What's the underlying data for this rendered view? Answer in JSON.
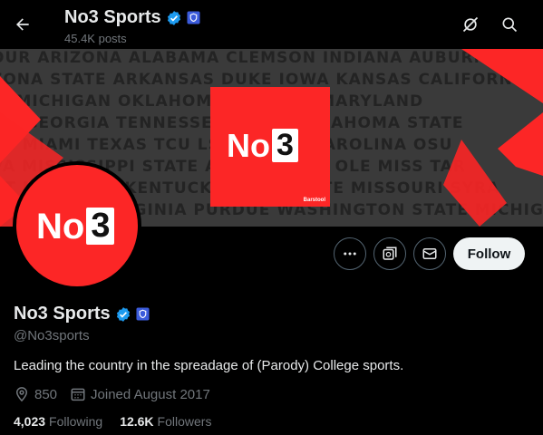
{
  "header": {
    "title": "No3 Sports",
    "posts": "45.4K posts"
  },
  "banner": {
    "logo_text": "No",
    "logo_digit": "3",
    "tag": "Barstool",
    "rows": [
      "OUR   ARIZONA   ALABAMA   CLEMSON   INDIANA   AUBURN",
      "ZONA STATE   ARKANSAS   DUKE   IOWA   KANSAS   CALIFORNIA",
      "IS   MICHIGAN   OKLAHOMA               FLORIDA   MARYLAND",
      "ON   GEORGIA   TENNESSEE               STATE   OKLAHOMA STATE",
      "NT   MIAMI   TEXAS   TCU               LSU   NORTH CAROLINA   OSU",
      "VA   MISSISSIPPI STATE                 AS TECH   USC   OLE MISS   TAR",
      "NT   MICHIGAN   KENTUCKY               IOWA STATE   MISSOURI   SYRA",
      "UN   ROLINA   VIRGINIA   PURDUE   WASHINGTON STATE   MICHIGAN"
    ]
  },
  "avatar": {
    "logo_text": "No",
    "logo_digit": "3"
  },
  "actions": {
    "follow_label": "Follow"
  },
  "profile": {
    "name": "No3 Sports",
    "handle": "@No3sports",
    "bio": "Leading the country in the spreadage of (Parody) College sports.",
    "location": "850",
    "joined": "Joined August 2017"
  },
  "stats": {
    "following_count": "4,023",
    "following_label": "Following",
    "followers_count": "12.6K",
    "followers_label": "Followers"
  },
  "colors": {
    "brand_red": "#fc2626",
    "verified_blue": "#1d9bf0",
    "gov_badge": "#3b5bdb"
  },
  "icons": [
    "back-arrow-icon",
    "verified-badge-icon",
    "government-badge-icon",
    "notifications-off-icon",
    "search-icon",
    "more-icon",
    "grok-icon",
    "message-icon",
    "location-icon",
    "calendar-icon"
  ]
}
